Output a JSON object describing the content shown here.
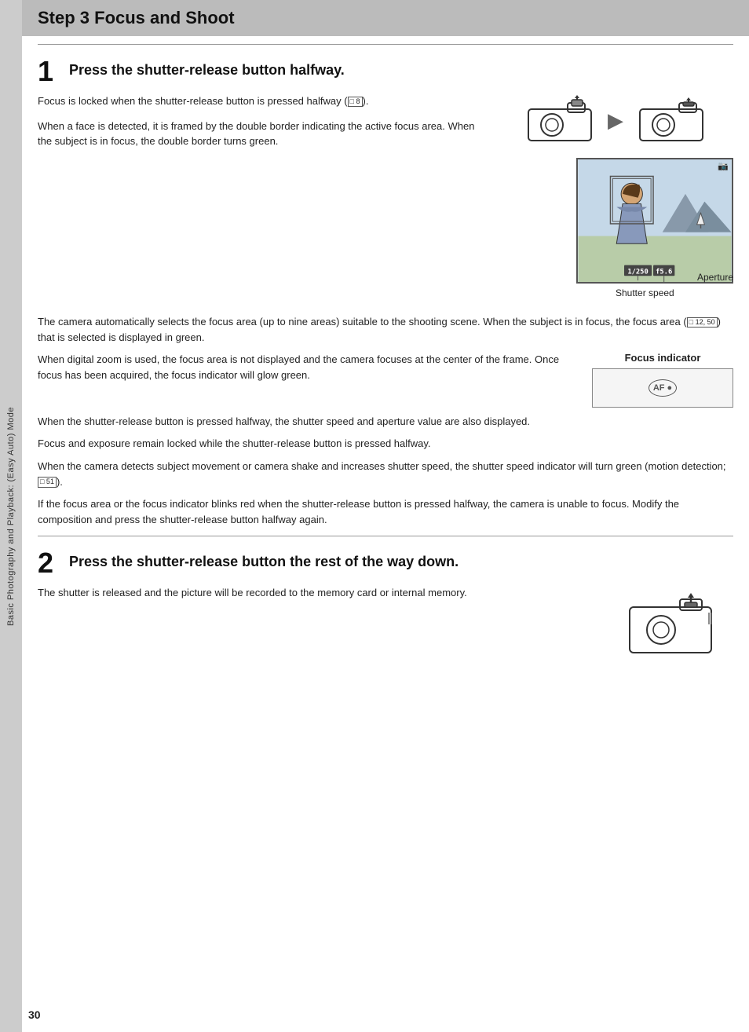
{
  "page": {
    "title": "Step 3 Focus and Shoot",
    "page_number": "30",
    "sidebar_text": "Basic Photography and Playback: (Easy Auto) Mode"
  },
  "step1": {
    "number": "1",
    "title": "Press the shutter-release button halfway.",
    "desc1": "Focus is locked when the shutter-release button is pressed halfway (",
    "ref1": "□ 8",
    "desc1_end": ").",
    "desc2": "When a face is detected, it is framed by the double border indicating the active focus area. When the subject is in focus, the double border turns green.",
    "shutter_speed_label": "Shutter speed",
    "aperture_label": "Aperture",
    "speed_value": "1/250",
    "aperture_value": "f5.6",
    "body1": "The camera automatically selects the focus area (up to nine areas) suitable to the shooting scene. When the subject is in focus, the focus area (",
    "body1_ref": "□ 12, 50",
    "body1_end": ") that is selected is displayed in green.",
    "body2": "When digital zoom is used, the focus area is not displayed and the camera focuses at the center of the frame. Once focus has been acquired, the focus indicator will glow green.",
    "focus_indicator_label": "Focus indicator",
    "body3": "When the shutter-release button is pressed halfway, the shutter speed and aperture value are also displayed.",
    "body4": "Focus and exposure remain locked while the shutter-release button is pressed halfway.",
    "body5": "When the camera detects subject movement or camera shake and increases shutter speed, the shutter speed indicator will turn green (motion detection; ",
    "body5_ref": "□ 51",
    "body5_end": ").",
    "body6": "If the focus area or the focus indicator blinks red when the shutter-release button is pressed halfway, the camera is unable to focus. Modify the composition and press the shutter-release button halfway again."
  },
  "step2": {
    "number": "2",
    "title": "Press the shutter-release button the rest of the way down.",
    "desc": "The shutter is released and the picture will be recorded to the memory card or internal memory."
  }
}
